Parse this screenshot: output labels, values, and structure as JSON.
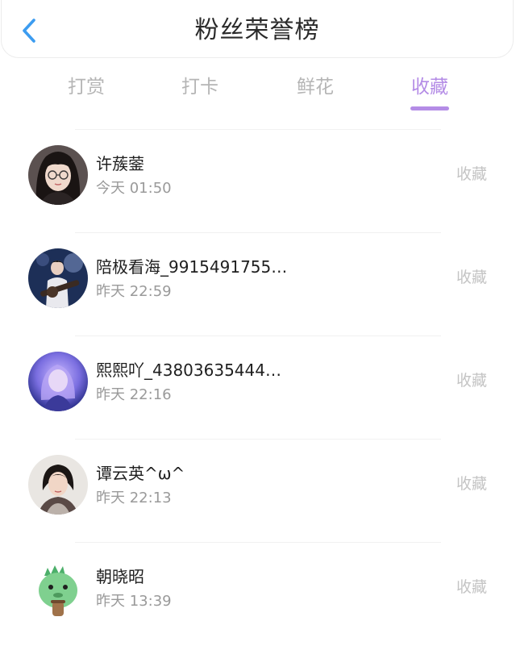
{
  "header": {
    "title": "粉丝荣誉榜"
  },
  "colors": {
    "accent": "#b48ce6",
    "back_icon": "#3c9cf0",
    "tab_inactive": "#b5b5b5"
  },
  "tabs": [
    {
      "label": "打赏",
      "active": false
    },
    {
      "label": "打卡",
      "active": false
    },
    {
      "label": "鲜花",
      "active": false
    },
    {
      "label": "收藏",
      "active": true
    }
  ],
  "list": [
    {
      "name": "许蔟蓥",
      "time": "今天  01:50",
      "action": "收藏",
      "avatar_icon": "avatar-girl-glasses"
    },
    {
      "name": "陪极看海_9915491755…",
      "time": "昨天  22:59",
      "action": "收藏",
      "avatar_icon": "avatar-guitarist-stage"
    },
    {
      "name": "熙熙吖_43803635444…",
      "time": "昨天  22:16",
      "action": "收藏",
      "avatar_icon": "avatar-purple-portrait"
    },
    {
      "name": "谭云英^ω^",
      "time": "昨天  22:13",
      "action": "收藏",
      "avatar_icon": "avatar-woman-photo"
    },
    {
      "name": "朝晓昭",
      "time": "昨天  13:39",
      "action": "收藏",
      "avatar_icon": "avatar-green-dinosaur"
    }
  ]
}
